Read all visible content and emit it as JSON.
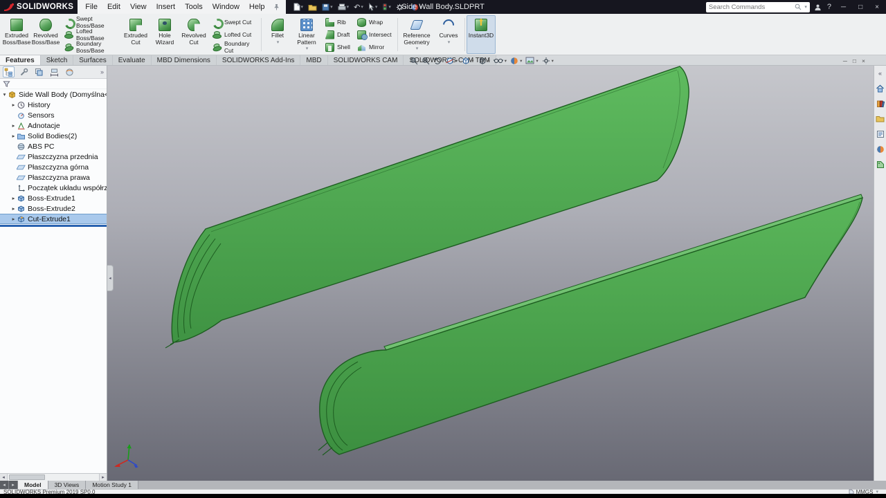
{
  "window": {
    "logo_text": "SOLIDWORKS",
    "document_title": "Side Wall Body.SLDPRT",
    "search_placeholder": "Search Commands"
  },
  "menubar": {
    "items": [
      "File",
      "Edit",
      "View",
      "Insert",
      "Tools",
      "Window",
      "Help"
    ]
  },
  "ribbon": {
    "buttons": [
      {
        "label": "Extruded Boss/Base"
      },
      {
        "label": "Revolved Boss/Base"
      },
      {
        "label": "Swept Boss/Base"
      },
      {
        "label": "Lofted Boss/Base"
      },
      {
        "label": "Boundary Boss/Base"
      },
      {
        "label": "Extruded Cut"
      },
      {
        "label": "Hole Wizard"
      },
      {
        "label": "Revolved Cut"
      },
      {
        "label": "Swept Cut"
      },
      {
        "label": "Lofted Cut"
      },
      {
        "label": "Boundary Cut"
      },
      {
        "label": "Fillet"
      },
      {
        "label": "Linear Pattern"
      },
      {
        "label": "Rib"
      },
      {
        "label": "Draft"
      },
      {
        "label": "Shell"
      },
      {
        "label": "Wrap"
      },
      {
        "label": "Intersect"
      },
      {
        "label": "Mirror"
      },
      {
        "label": "Reference Geometry"
      },
      {
        "label": "Curves"
      },
      {
        "label": "Instant3D"
      }
    ]
  },
  "tabs": {
    "items": [
      "Features",
      "Sketch",
      "Surfaces",
      "Evaluate",
      "MBD Dimensions",
      "SOLIDWORKS Add-Ins",
      "MBD",
      "SOLIDWORKS CAM",
      "SOLIDWORKS CAM TBM"
    ]
  },
  "tree": {
    "root": "Side Wall Body (Domyślna<<Domyśln",
    "items": [
      "History",
      "Sensors",
      "Adnotacje",
      "Solid Bodies(2)",
      "ABS PC",
      "Płaszczyzna przednia",
      "Płaszczyzna górna",
      "Płaszczyzna prawa",
      "Początek układu współrzędnych",
      "Boss-Extrude1",
      "Boss-Extrude2",
      "Cut-Extrude1"
    ]
  },
  "bottom_tabs": [
    "Model",
    "3D Views",
    "Motion Study 1"
  ],
  "status": {
    "left": "SOLIDWORKS Premium 2019 SP0.0",
    "units": "MMGS"
  },
  "icons": {
    "chevron_down": "▾",
    "expand_closed": "▸",
    "expand_open": "▾",
    "scroll_left": "◂",
    "scroll_right": "▸",
    "chevrons_left": "«",
    "chevrons_right": "»",
    "minimize": "─",
    "maximize": "□",
    "close": "×",
    "help": "?",
    "undo": "↶"
  },
  "colors": {
    "body_green": "#4aa04c",
    "selection_blue": "#a9c9ec",
    "logo_red": "#d8262c",
    "rollback_blue": "#2a63b0",
    "viewport_top": "#c6c7cc",
    "viewport_bottom": "#686974"
  }
}
